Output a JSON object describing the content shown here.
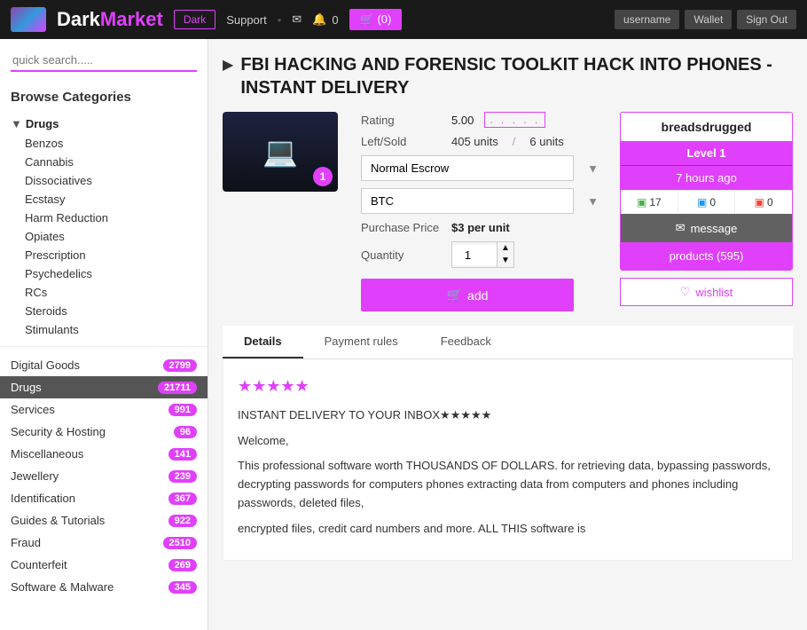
{
  "topnav": {
    "logo": "DarkMarket",
    "dark_btn": "Dark",
    "support_link": "Support",
    "cart_label": "(0)",
    "user_btn1": "username",
    "user_btn2": "Wallet",
    "user_btn3": "Sign Out"
  },
  "sidebar": {
    "search_placeholder": "quick search.....",
    "browse_title": "Browse Categories",
    "drugs_parent": "Drugs",
    "drug_children": [
      "Benzos",
      "Cannabis",
      "Dissociatives",
      "Ecstasy",
      "Harm Reduction",
      "Opiates",
      "Prescription",
      "Psychedelics",
      "RCs",
      "Steroids",
      "Stimulants"
    ],
    "categories": [
      {
        "label": "Digital Goods",
        "count": "2799",
        "active": false
      },
      {
        "label": "Drugs",
        "count": "21711",
        "active": true
      },
      {
        "label": "Services",
        "count": "991",
        "active": false
      },
      {
        "label": "Security & Hosting",
        "count": "96",
        "active": false
      },
      {
        "label": "Miscellaneous",
        "count": "141",
        "active": false
      },
      {
        "label": "Jewellery",
        "count": "239",
        "active": false
      },
      {
        "label": "Identification",
        "count": "367",
        "active": false
      },
      {
        "label": "Guides & Tutorials",
        "count": "922",
        "active": false
      },
      {
        "label": "Fraud",
        "count": "2510",
        "active": false
      },
      {
        "label": "Counterfeit",
        "count": "269",
        "active": false
      },
      {
        "label": "Software & Malware",
        "count": "345",
        "active": false
      }
    ]
  },
  "product": {
    "title": "FBI HACKING AND FORENSIC TOOLKIT HACK INTO PHONES - INSTANT DELIVERY",
    "rating_label": "Rating",
    "rating_value": "5.00",
    "left_sold_label": "Left/Sold",
    "units_left": "405 units",
    "units_sold": "6 units",
    "escrow_option": "Normal Escrow",
    "currency_option": "BTC",
    "purchase_price_label": "Purchase Price",
    "purchase_price": "$3 per unit",
    "quantity_label": "Quantity",
    "quantity_value": "1",
    "add_label": "add"
  },
  "seller": {
    "name": "breadsdrugged",
    "level": "Level 1",
    "time_ago": "7 hours ago",
    "stat_positive": "17",
    "stat_neutral": "0",
    "stat_negative": "0",
    "message_label": "message",
    "products_label": "products (595)",
    "wishlist_label": "wishlist"
  },
  "tabs": [
    {
      "label": "Details",
      "active": true
    },
    {
      "label": "Payment rules",
      "active": false
    },
    {
      "label": "Feedback",
      "active": false
    }
  ],
  "detail": {
    "stars": "★★★★★",
    "tagline": "INSTANT DELIVERY TO YOUR INBOX★★★★★",
    "welcome": "Welcome,",
    "body1": "This professional software worth THOUSANDS OF DOLLARS. for retrieving data, bypassing passwords, decrypting passwords for computers phones extracting data from computers and phones including passwords, deleted files,",
    "body2": "encrypted files, credit card numbers and more. ALL THIS software is"
  }
}
